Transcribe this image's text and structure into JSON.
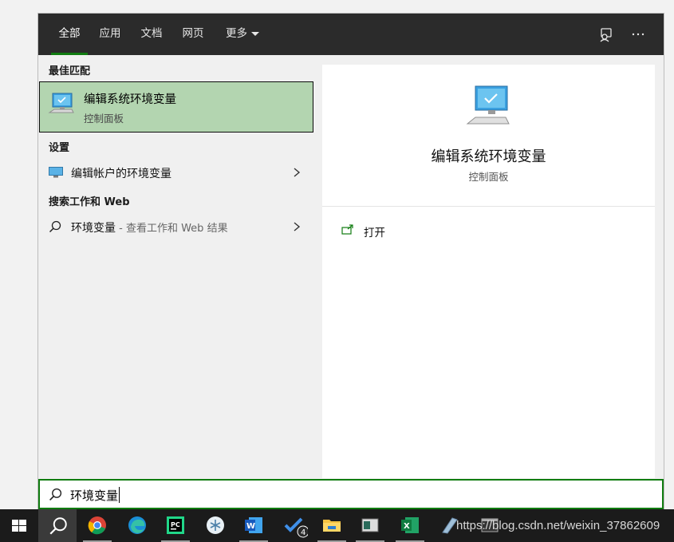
{
  "tabs": [
    {
      "label": "全部",
      "active": true
    },
    {
      "label": "应用"
    },
    {
      "label": "文档"
    },
    {
      "label": "网页"
    },
    {
      "label": "更多"
    }
  ],
  "top_icons": [
    "feedback-icon",
    "more-options-icon"
  ],
  "results": {
    "best_match_heading": "最佳匹配",
    "best_match": {
      "title": "编辑系统环境变量",
      "subtitle": "控制面板",
      "icon": "computer-monitor-icon"
    },
    "settings_heading": "设置",
    "settings_item": {
      "label": "编辑帐户的环境变量",
      "icon": "monitor-settings-icon"
    },
    "web_heading": "搜索工作和 Web",
    "web_item": {
      "label": "环境变量",
      "hint": " - 查看工作和 Web 结果",
      "icon": "search-icon"
    }
  },
  "detail": {
    "title": "编辑系统环境变量",
    "subtitle": "控制面板",
    "actions": [
      {
        "label": "打开",
        "icon": "open-icon"
      }
    ]
  },
  "search": {
    "value": "环境变量",
    "icon": "search-icon"
  },
  "taskbar": {
    "items": [
      "windows-start-icon",
      "search-icon",
      "chrome-icon",
      "edge-icon",
      "pycharm-icon",
      "bug-app-icon",
      "word-icon",
      "todo-icon",
      "file-explorer-icon",
      "window-app-icon",
      "excel-icon",
      "pen-app-icon",
      "terminal-icon"
    ],
    "todo_badge": "4"
  },
  "watermark": "https://blog.csdn.net/weixin_37862609",
  "colors": {
    "accent": "#107c10",
    "selected_bg": "#b3d5b0",
    "topbar": "#2b2b2b"
  }
}
